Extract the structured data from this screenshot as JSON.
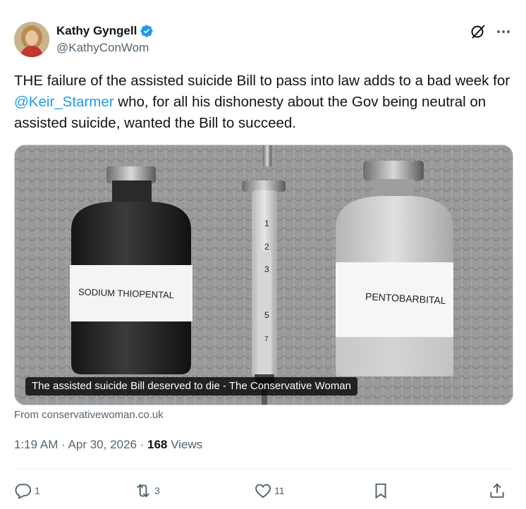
{
  "author": {
    "name": "Kathy Gyngell",
    "handle": "@KathyConWom",
    "verified": true,
    "verified_color": "#1d9bf0"
  },
  "tweet": {
    "text_before": "THE failure of the assisted suicide Bill to pass into law adds to a bad week for ",
    "mention": "@Keir_Starmer",
    "text_after": " who, for all his dishonesty about the Gov being neutral on assisted suicide, wanted the Bill to succeed.",
    "mention_color": "#1d9bf0"
  },
  "media": {
    "caption": "The assisted suicide Bill deserved to die - The Conservative Woman",
    "left_label": "SODIUM THIOPENTAL",
    "right_label": "PENTOBARBITAL",
    "syringe_marks": [
      "1",
      "2",
      "3",
      "5",
      "7"
    ]
  },
  "link_source": "From conservativewoman.co.uk",
  "meta": {
    "time_date": "1:19 AM · Apr 30, 2026 · ",
    "views_count": "168",
    "views_label": " Views"
  },
  "actions": {
    "replies": "1",
    "reposts": "3",
    "likes": "11"
  },
  "icons": {
    "grok": "grok-icon",
    "more": "more-icon",
    "reply": "reply-icon",
    "repost": "repost-icon",
    "like": "like-icon",
    "bookmark": "bookmark-icon",
    "share": "share-icon"
  }
}
